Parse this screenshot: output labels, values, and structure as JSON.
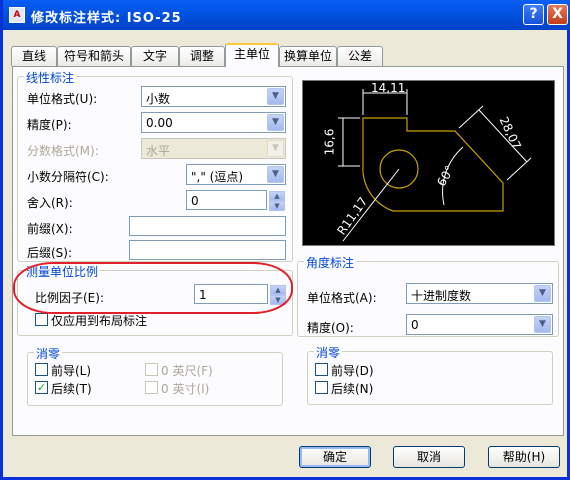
{
  "window": {
    "title": "修改标注样式: ISO-25",
    "help_btn": "?",
    "close_btn": "X",
    "app_icon_text": "A"
  },
  "tabs": [
    "直线",
    "符号和箭头",
    "文字",
    "调整",
    "主单位",
    "换算单位",
    "公差"
  ],
  "active_tab": "主单位",
  "linear": {
    "group_label": "线性标注",
    "unit_format_label": "单位格式(U):",
    "unit_format_value": "小数",
    "precision_label": "精度(P):",
    "precision_value": "0.00",
    "fraction_label": "分数格式(M):",
    "fraction_value": "水平",
    "decimal_sep_label": "小数分隔符(C):",
    "decimal_sep_value": "\",\" (逗点)",
    "round_label": "舍入(R):",
    "round_value": "0",
    "prefix_label": "前缀(X):",
    "prefix_value": "",
    "suffix_label": "后缀(S):",
    "suffix_value": ""
  },
  "scale": {
    "group_label": "测量单位比例",
    "factor_label": "比例因子(E):",
    "factor_value": "1",
    "layout_only_label": "仅应用到布局标注",
    "layout_only_checked": false
  },
  "zero_left": {
    "group_label": "消零",
    "leading_label": "前导(L)",
    "leading_checked": false,
    "trailing_label": "后续(T)",
    "trailing_checked": true,
    "feet_label": "0 英尺(F)",
    "inches_label": "0 英寸(I)"
  },
  "preview": {
    "dim_top": "14,11",
    "dim_left": "16,6",
    "dim_right": "28,07",
    "angle": "60°",
    "radius": "R11,17"
  },
  "angular": {
    "group_label": "角度标注",
    "unit_format_label": "单位格式(A):",
    "unit_format_value": "十进制度数",
    "precision_label": "精度(O):",
    "precision_value": "0"
  },
  "zero_right": {
    "group_label": "消零",
    "leading_label": "前导(D)",
    "leading_checked": false,
    "trailing_label": "后续(N)",
    "trailing_checked": false
  },
  "buttons": {
    "ok": "确定",
    "cancel": "取消",
    "help": "帮助(H)"
  },
  "colors": {
    "title_bar": "#0054e3",
    "group_label": "#0046d5",
    "preview_geometry": "#c8a000",
    "preview_dims": "#ffffff",
    "annotation": "#e0202a"
  }
}
